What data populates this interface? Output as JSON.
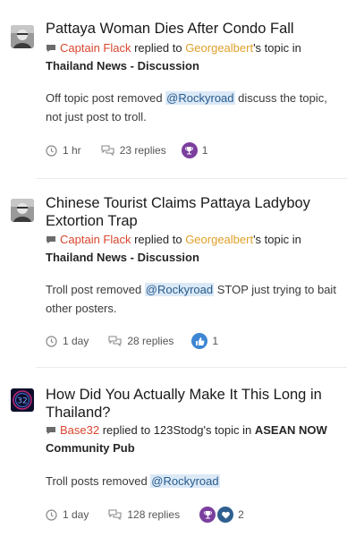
{
  "posts": [
    {
      "title": "Pattaya Woman Dies After Condo Fall",
      "author": "Captain Flack",
      "action": " replied to ",
      "topic_owner": "Georgealbert",
      "topic_suffix": "'s topic in",
      "forum": "Thailand News - Discussion",
      "snippet_pre": "Off topic post removed ",
      "mention": "@Rockyroad",
      "snippet_post": " discuss the topic, not just post to troll.",
      "time": "1 hr",
      "replies": "23 replies",
      "reaction_icons": [
        "trophy-icon"
      ],
      "reaction_count": "1"
    },
    {
      "title": "Chinese Tourist Claims Pattaya Ladyboy Extortion Trap",
      "author": "Captain Flack",
      "action": " replied to ",
      "topic_owner": "Georgealbert",
      "topic_suffix": "'s topic in",
      "forum": "Thailand News - Discussion",
      "snippet_pre": "Troll post removed ",
      "mention": "@Rockyroad",
      "snippet_post": " STOP just trying to bait other posters.",
      "time": "1 day",
      "replies": "28 replies",
      "reaction_icons": [
        "thumbs-up-icon"
      ],
      "reaction_count": "1"
    },
    {
      "title": "How Did You Actually Make It This Long in Thailand?",
      "author": "Base32",
      "action": " replied to 123Stodg's topic in ",
      "forum_inline": "ASEAN NOW",
      "forum": "Community Pub",
      "snippet_pre": "Troll posts removed ",
      "mention": "@Rockyroad",
      "snippet_post": "",
      "time": "1 day",
      "replies": "128 replies",
      "reaction_icons": [
        "trophy-icon",
        "heart-icon"
      ],
      "reaction_count": "2",
      "avatar_text": "32"
    }
  ],
  "colors": {
    "author": "#d9462e",
    "topic_owner": "#e0a02a",
    "mention_bg": "#dbe9f7",
    "trophy_badge": "#7b3f9e",
    "like_badge": "#3d86d3",
    "heart_badge": "#2e5f8f"
  }
}
